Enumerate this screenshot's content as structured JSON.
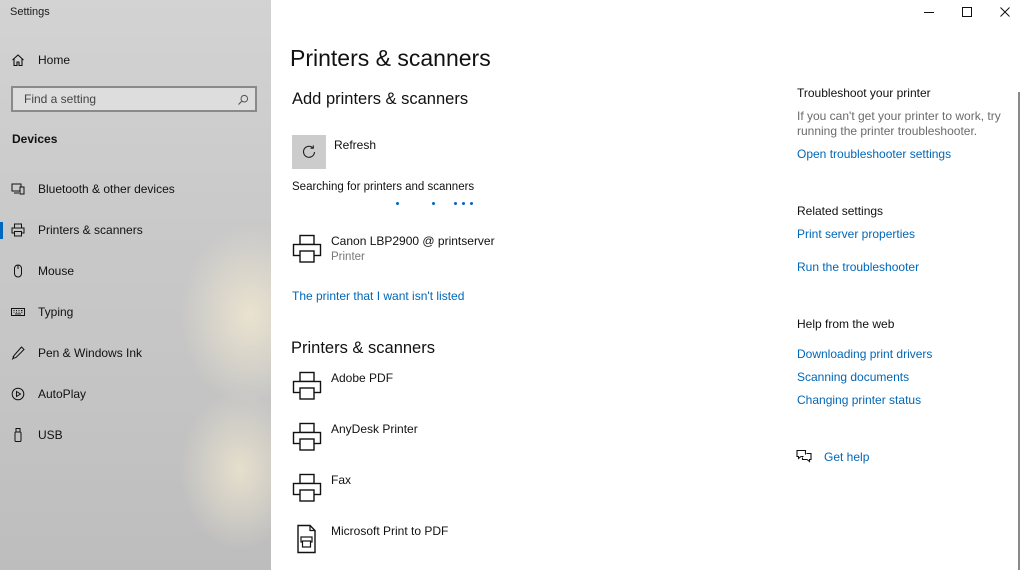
{
  "app": {
    "title": "Settings"
  },
  "sidebar": {
    "home_label": "Home",
    "search_placeholder": "Find a setting",
    "section_label": "Devices",
    "items": [
      {
        "label": "Bluetooth & other devices",
        "icon": "bluetooth-devices-icon"
      },
      {
        "label": "Printers & scanners",
        "icon": "printer-icon",
        "selected": true
      },
      {
        "label": "Mouse",
        "icon": "mouse-icon"
      },
      {
        "label": "Typing",
        "icon": "keyboard-icon"
      },
      {
        "label": "Pen & Windows Ink",
        "icon": "pen-icon"
      },
      {
        "label": "AutoPlay",
        "icon": "autoplay-icon"
      },
      {
        "label": "USB",
        "icon": "usb-icon"
      }
    ]
  },
  "main": {
    "page_title": "Printers & scanners",
    "add_section_title": "Add printers & scanners",
    "refresh_label": "Refresh",
    "searching_text": "Searching for printers and scanners",
    "found_device": {
      "name": "Canon LBP2900 @ printserver",
      "type": "Printer"
    },
    "not_listed_link": "The printer that I want isn't listed",
    "list_section_title": "Printers & scanners",
    "printers": [
      {
        "name": "Adobe PDF",
        "icon": "printer-icon"
      },
      {
        "name": "AnyDesk Printer",
        "icon": "printer-icon"
      },
      {
        "name": "Fax",
        "icon": "printer-icon"
      },
      {
        "name": "Microsoft Print to PDF",
        "icon": "pdf-printer-icon"
      }
    ]
  },
  "right": {
    "troubleshoot": {
      "heading": "Troubleshoot your printer",
      "text": "If you can't get your printer to work, try running the printer troubleshooter.",
      "link": "Open troubleshooter settings"
    },
    "related": {
      "heading": "Related settings",
      "links": [
        "Print server properties",
        "Run the troubleshooter"
      ]
    },
    "help": {
      "heading": "Help from the web",
      "links": [
        "Downloading print drivers",
        "Scanning documents",
        "Changing printer status"
      ]
    },
    "get_help": "Get help"
  },
  "colors": {
    "accent": "#0067c0",
    "link": "#0067b8",
    "secondary_text": "#767676"
  }
}
